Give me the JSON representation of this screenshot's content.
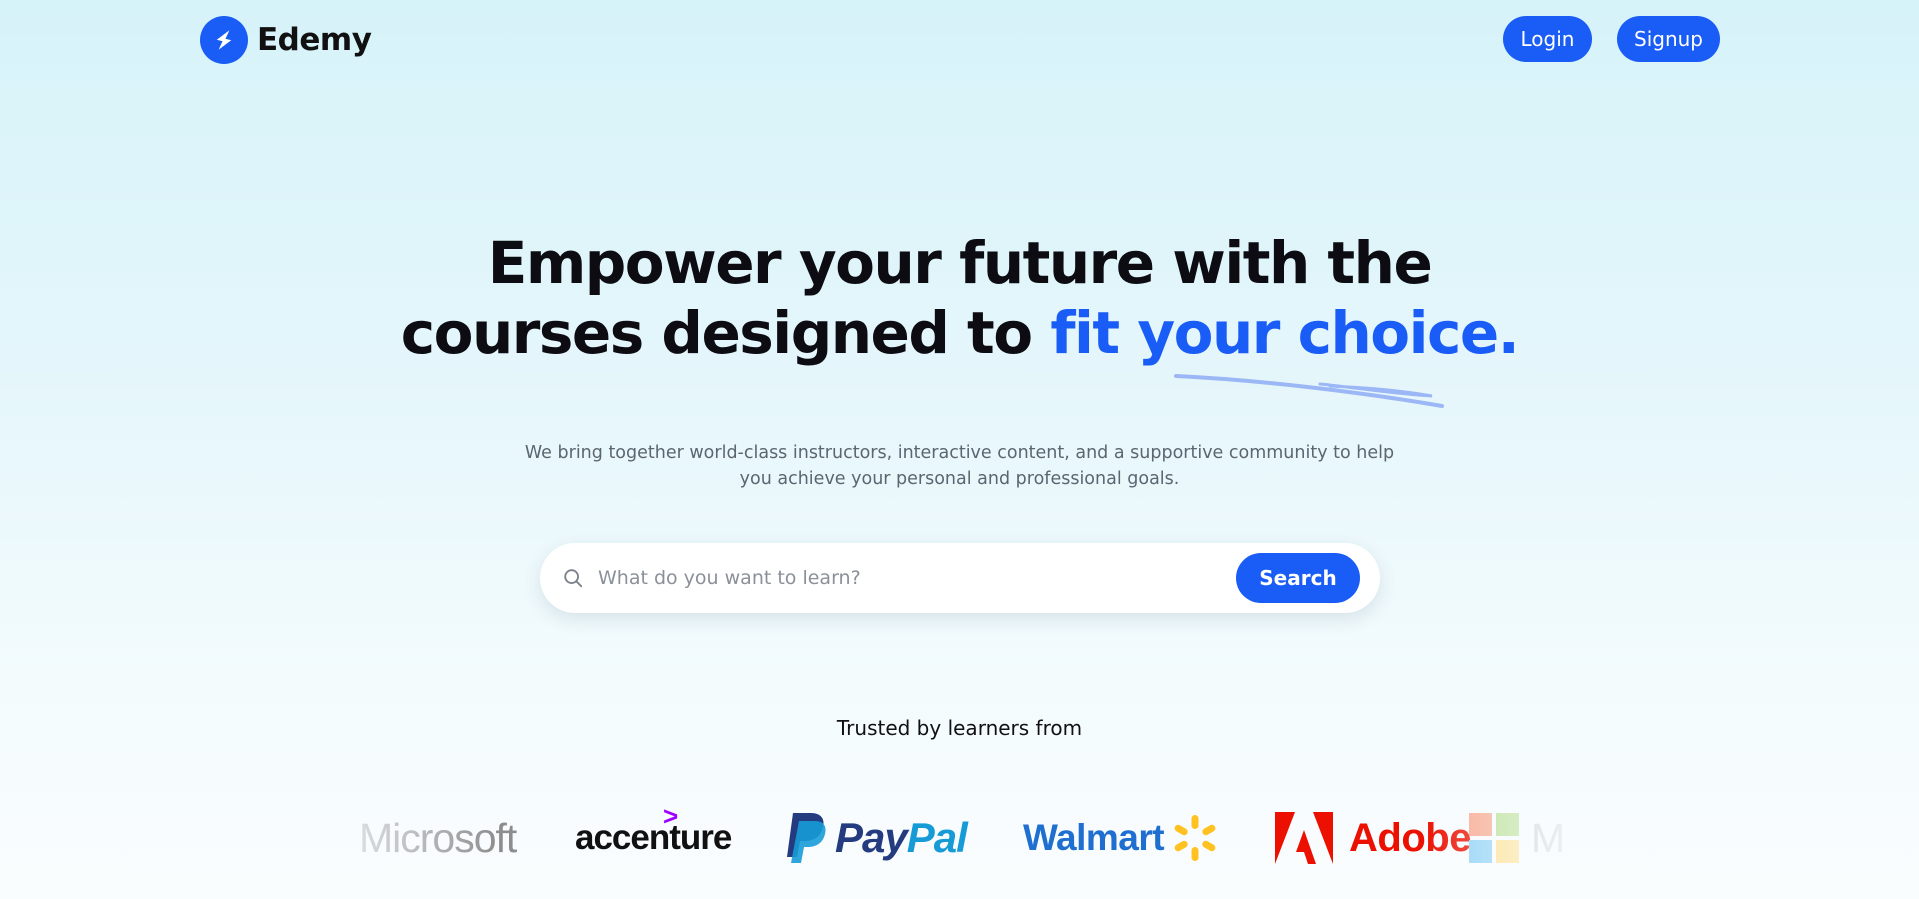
{
  "brand": {
    "name": "Edemy",
    "logo_icon": "lightning-bolt-icon",
    "color": "#1a5cf6"
  },
  "nav": {
    "login_label": "Login",
    "signup_label": "Signup"
  },
  "hero": {
    "title_line1": "Empower your future with the",
    "title_line2_prefix": "courses designed to ",
    "title_highlight": "fit your choice.",
    "subtitle_line1": "We bring together world-class instructors, interactive content, and a supportive community to help",
    "subtitle_line2": "you achieve your personal and professional goals."
  },
  "search": {
    "placeholder": "What do you want to learn?",
    "value": "",
    "button_label": "Search",
    "icon": "search-icon"
  },
  "trusted": {
    "label": "Trusted by learners from",
    "logos": [
      {
        "name": "Microsoft",
        "text": "Microsoft",
        "color": "#8d8d8d"
      },
      {
        "name": "Accenture",
        "text": "accenture",
        "mark": ">",
        "color": "#111111",
        "accent": "#a100ff"
      },
      {
        "name": "PayPal",
        "text_a": "Pay",
        "text_b": "Pal",
        "color": "#253b80",
        "accent": "#179bd7"
      },
      {
        "name": "Walmart",
        "text": "Walmart",
        "color": "#1f6fd1",
        "accent": "#ffc220"
      },
      {
        "name": "Adobe",
        "text": "Adobe",
        "color": "#eb1000"
      },
      {
        "name": "Microsoft",
        "text": "M",
        "color": "#c9c9c9"
      }
    ]
  },
  "colors": {
    "accent": "#1a5cf6",
    "text_dark": "#0c0c12",
    "text_muted": "#5c6570"
  }
}
